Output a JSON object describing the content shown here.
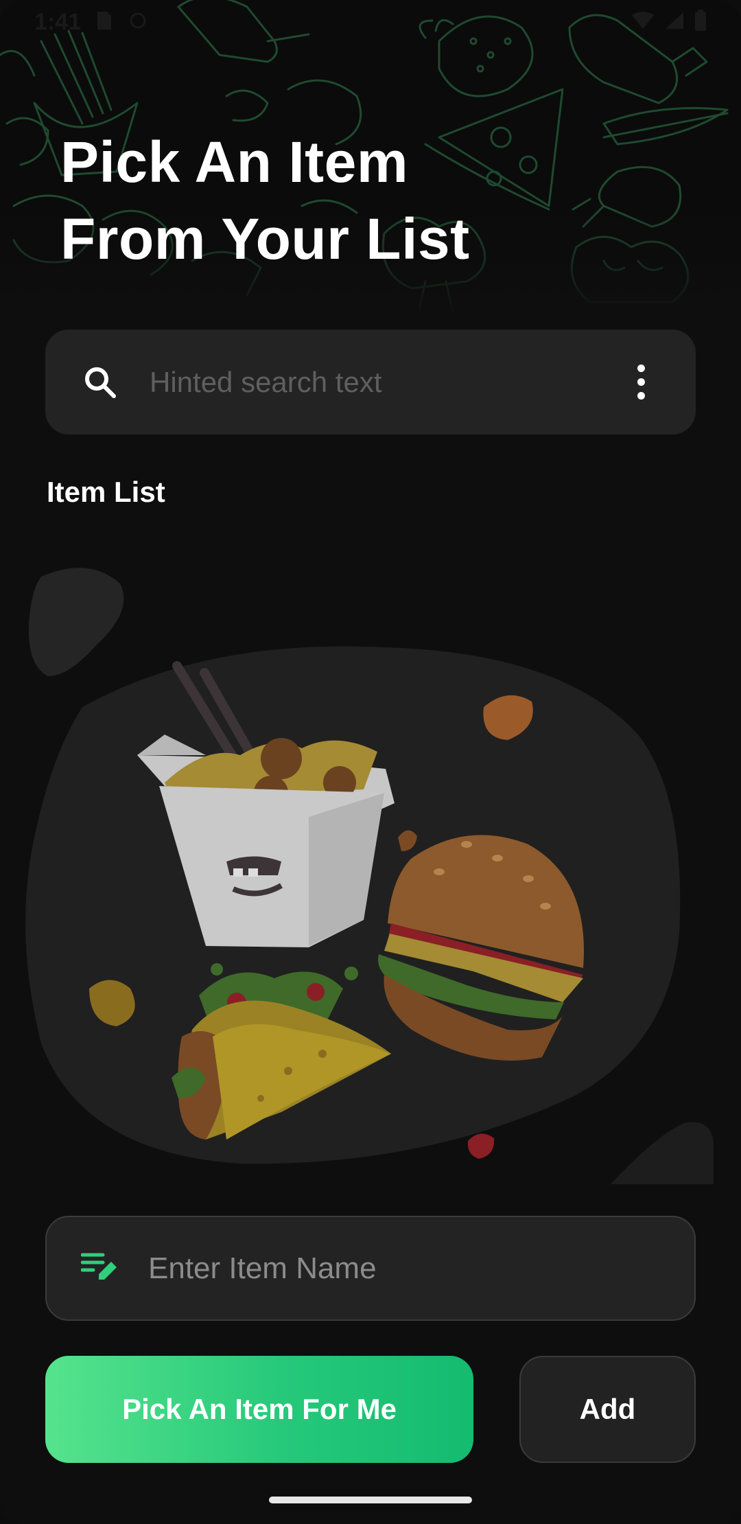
{
  "status_bar": {
    "time": "1:41"
  },
  "header": {
    "title_line1": "Pick An Item",
    "title_line2": "From Your List"
  },
  "search": {
    "placeholder": "Hinted search text",
    "icon": "search-icon",
    "menu_icon": "more-vert-icon"
  },
  "section": {
    "label": "Item List"
  },
  "item_input": {
    "placeholder": "Enter Item Name",
    "icon": "edit-list-icon"
  },
  "actions": {
    "pick_label": "Pick An Item For Me",
    "add_label": "Add"
  },
  "colors": {
    "background": "#0e0e0e",
    "surface": "#232323",
    "accent_start": "#56e38d",
    "accent_end": "#14bb70",
    "doodle": "#1f4a30"
  }
}
